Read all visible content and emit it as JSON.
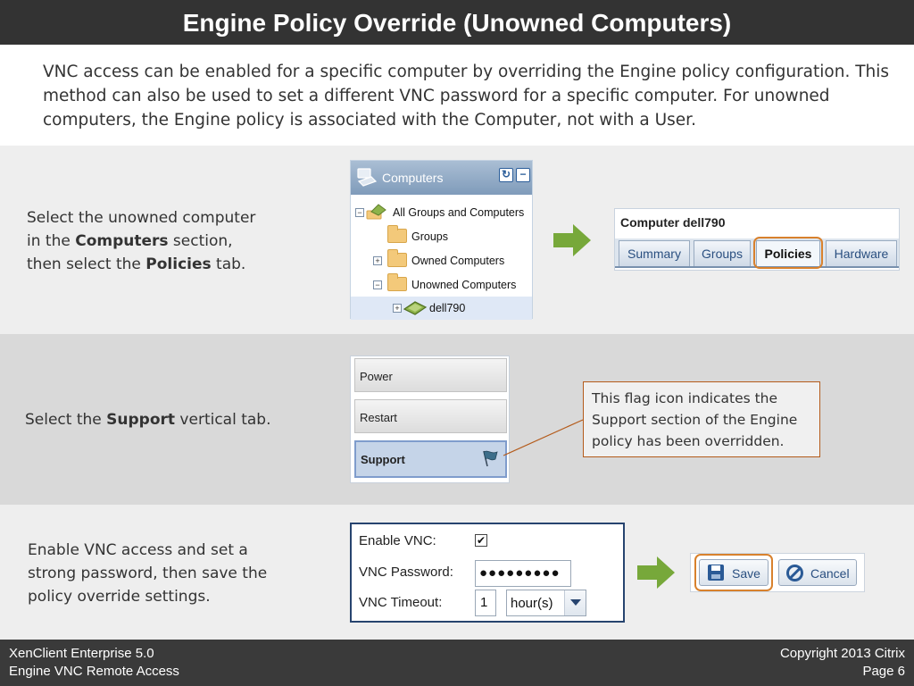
{
  "slide": {
    "title": "Engine Policy Override (Unowned Computers)",
    "intro": "VNC access can be enabled for a specific computer by overriding the Engine policy configuration. This method can also be used to set a different VNC password for a specific computer.  For unowned computers, the Engine policy is associated with the Computer, not with a User."
  },
  "step1": {
    "line1": "Select the unowned computer",
    "line2_pre": "in the ",
    "line2_bold": "Computers",
    "line2_post": " section,",
    "line3_pre": "then select the ",
    "line3_bold": "Policies",
    "line3_post": " tab."
  },
  "computers_panel": {
    "header": "Computers",
    "refresh_symbol": "↻",
    "collapse_symbol": "−",
    "items": [
      {
        "label": "All Groups and Computers",
        "expander": "−"
      },
      {
        "label": "Groups",
        "expander": ""
      },
      {
        "label": "Owned Computers",
        "expander": "+"
      },
      {
        "label": "Unowned Computers",
        "expander": "−"
      },
      {
        "label": "dell790",
        "expander": "+"
      }
    ]
  },
  "computer_panel": {
    "title": "Computer dell790",
    "tabs": [
      "Summary",
      "Groups",
      "Policies",
      "Hardware"
    ],
    "active_tab": "Policies"
  },
  "step2": {
    "pre": "Select the ",
    "bold": "Support",
    "post": " vertical tab."
  },
  "vertical_tabs": {
    "items": [
      "Power",
      "Restart",
      "Support"
    ],
    "selected": "Support"
  },
  "callout": {
    "text": "This flag icon indicates the Support section of the Engine policy has been overridden."
  },
  "step3": {
    "text": "Enable VNC access and set a strong password, then save the policy override settings."
  },
  "vnc_settings": {
    "enable_label": "Enable VNC:",
    "enable_checked_mark": "✔",
    "password_label": "VNC Password:",
    "password_value": "●●●●●●●●●",
    "timeout_label": "VNC Timeout:",
    "timeout_value": "1",
    "timeout_unit": "hour(s)"
  },
  "buttons": {
    "save": "Save",
    "cancel": "Cancel"
  },
  "footer": {
    "product": "XenClient Enterprise 5.0",
    "subtitle": "Engine VNC Remote Access",
    "copyright": "Copyright 2013 Citrix",
    "page": "Page 6"
  },
  "colors": {
    "title_bar": "#333333",
    "highlight_orange": "#d8812d",
    "arrow_green": "#77a83a",
    "accent_blue": "#2a5a96"
  }
}
